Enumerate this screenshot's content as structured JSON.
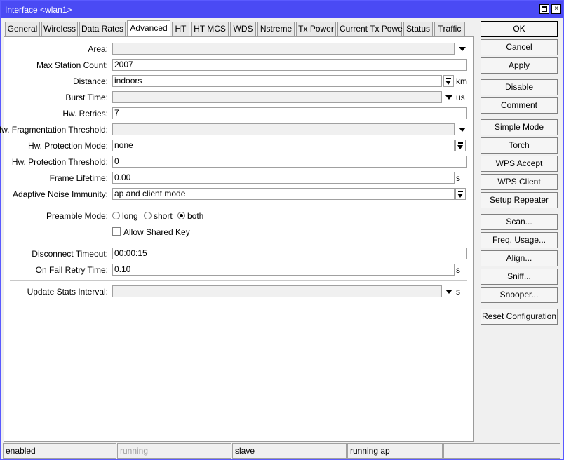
{
  "window": {
    "title": "Interface <wlan1>",
    "close_glyph": "×"
  },
  "tabs": [
    "General",
    "Wireless",
    "Data Rates",
    "Advanced",
    "HT",
    "HT MCS",
    "WDS",
    "Nstreme",
    "Tx Power",
    "Current Tx Power",
    "Status",
    "Traffic"
  ],
  "active_tab": "Advanced",
  "form": {
    "area": {
      "label": "Area:",
      "value": ""
    },
    "max_station_count": {
      "label": "Max Station Count:",
      "value": "2007"
    },
    "distance": {
      "label": "Distance:",
      "value": "indoors",
      "unit": "km"
    },
    "burst_time": {
      "label": "Burst Time:",
      "value": "",
      "unit": "us"
    },
    "hw_retries": {
      "label": "Hw. Retries:",
      "value": "7"
    },
    "hw_frag_threshold": {
      "label": "Hw. Fragmentation Threshold:",
      "value": ""
    },
    "hw_protection_mode": {
      "label": "Hw. Protection Mode:",
      "value": "none"
    },
    "hw_protection_threshold": {
      "label": "Hw. Protection Threshold:",
      "value": "0"
    },
    "frame_lifetime": {
      "label": "Frame Lifetime:",
      "value": "0.00",
      "unit": "s"
    },
    "adaptive_noise_immunity": {
      "label": "Adaptive Noise Immunity:",
      "value": "ap and client mode"
    },
    "preamble_mode": {
      "label": "Preamble Mode:",
      "options": [
        "long",
        "short",
        "both"
      ],
      "selected": "both"
    },
    "allow_shared_key": {
      "label": "Allow Shared Key",
      "checked": false
    },
    "disconnect_timeout": {
      "label": "Disconnect Timeout:",
      "value": "00:00:15"
    },
    "on_fail_retry_time": {
      "label": "On Fail Retry Time:",
      "value": "0.10",
      "unit": "s"
    },
    "update_stats_interval": {
      "label": "Update Stats Interval:",
      "value": "",
      "unit": "s"
    }
  },
  "buttons": {
    "ok": "OK",
    "cancel": "Cancel",
    "apply": "Apply",
    "disable": "Disable",
    "comment": "Comment",
    "simple_mode": "Simple Mode",
    "torch": "Torch",
    "wps_accept": "WPS Accept",
    "wps_client": "WPS Client",
    "setup_repeater": "Setup Repeater",
    "scan": "Scan...",
    "freq_usage": "Freq. Usage...",
    "align": "Align...",
    "sniff": "Sniff...",
    "snooper": "Snooper...",
    "reset_configuration": "Reset Configuration"
  },
  "status": {
    "enabled": "enabled",
    "running": "running",
    "slave": "slave",
    "running_ap": "running ap",
    "extra": ""
  }
}
